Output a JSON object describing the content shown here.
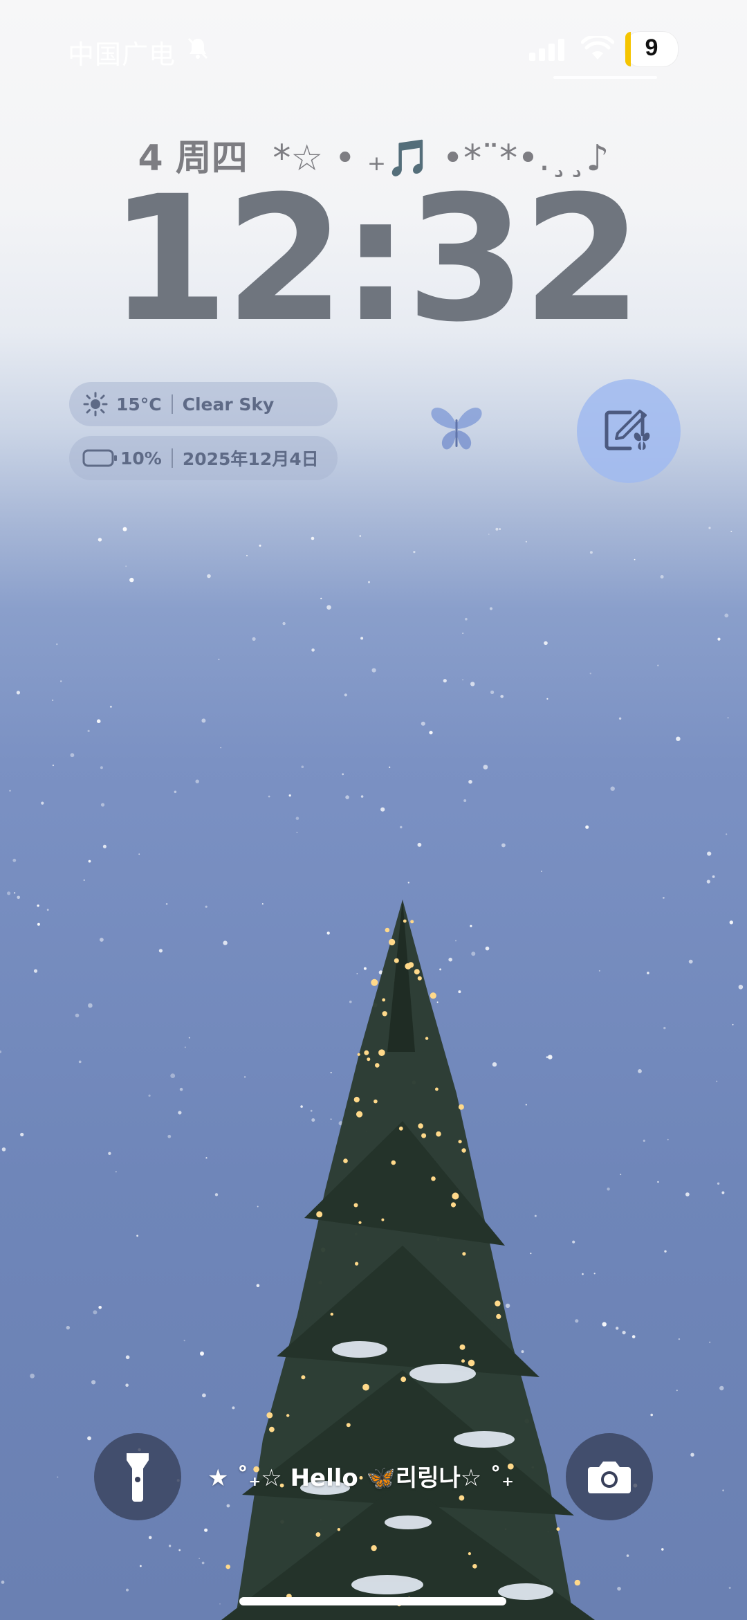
{
  "status_bar": {
    "carrier": "中国广电",
    "battery_level": "9",
    "icons": [
      "bell-muted-icon",
      "signal-icon",
      "wifi-icon",
      "battery-icon"
    ]
  },
  "lock_screen": {
    "date": "4 周四",
    "date_decoration": "*☆ • ₊🎵 •*¨*•.¸¸♪",
    "time": "12:32"
  },
  "widgets": {
    "weather": {
      "icon": "sun-icon",
      "temperature": "15°C",
      "condition": "Clear Sky"
    },
    "battery_date": {
      "icon": "battery-outline-icon",
      "percent": "10%",
      "date": "2025年12月4日"
    },
    "butterfly_icon": "butterfly-icon",
    "edit_button_icon": "edit-wallpaper-icon"
  },
  "bottom": {
    "flashlight_icon": "flashlight-icon",
    "camera_icon": "camera-icon",
    "text": "★ ˚₊☆ Hello 🦋리링나☆ ˚₊"
  },
  "colors": {
    "clock": "#6f757e",
    "sky_top": "#f7f7f8",
    "sky_bottom": "#6a80b2",
    "edit_button": "#a0baf0",
    "battery_accent": "#f5c400"
  }
}
